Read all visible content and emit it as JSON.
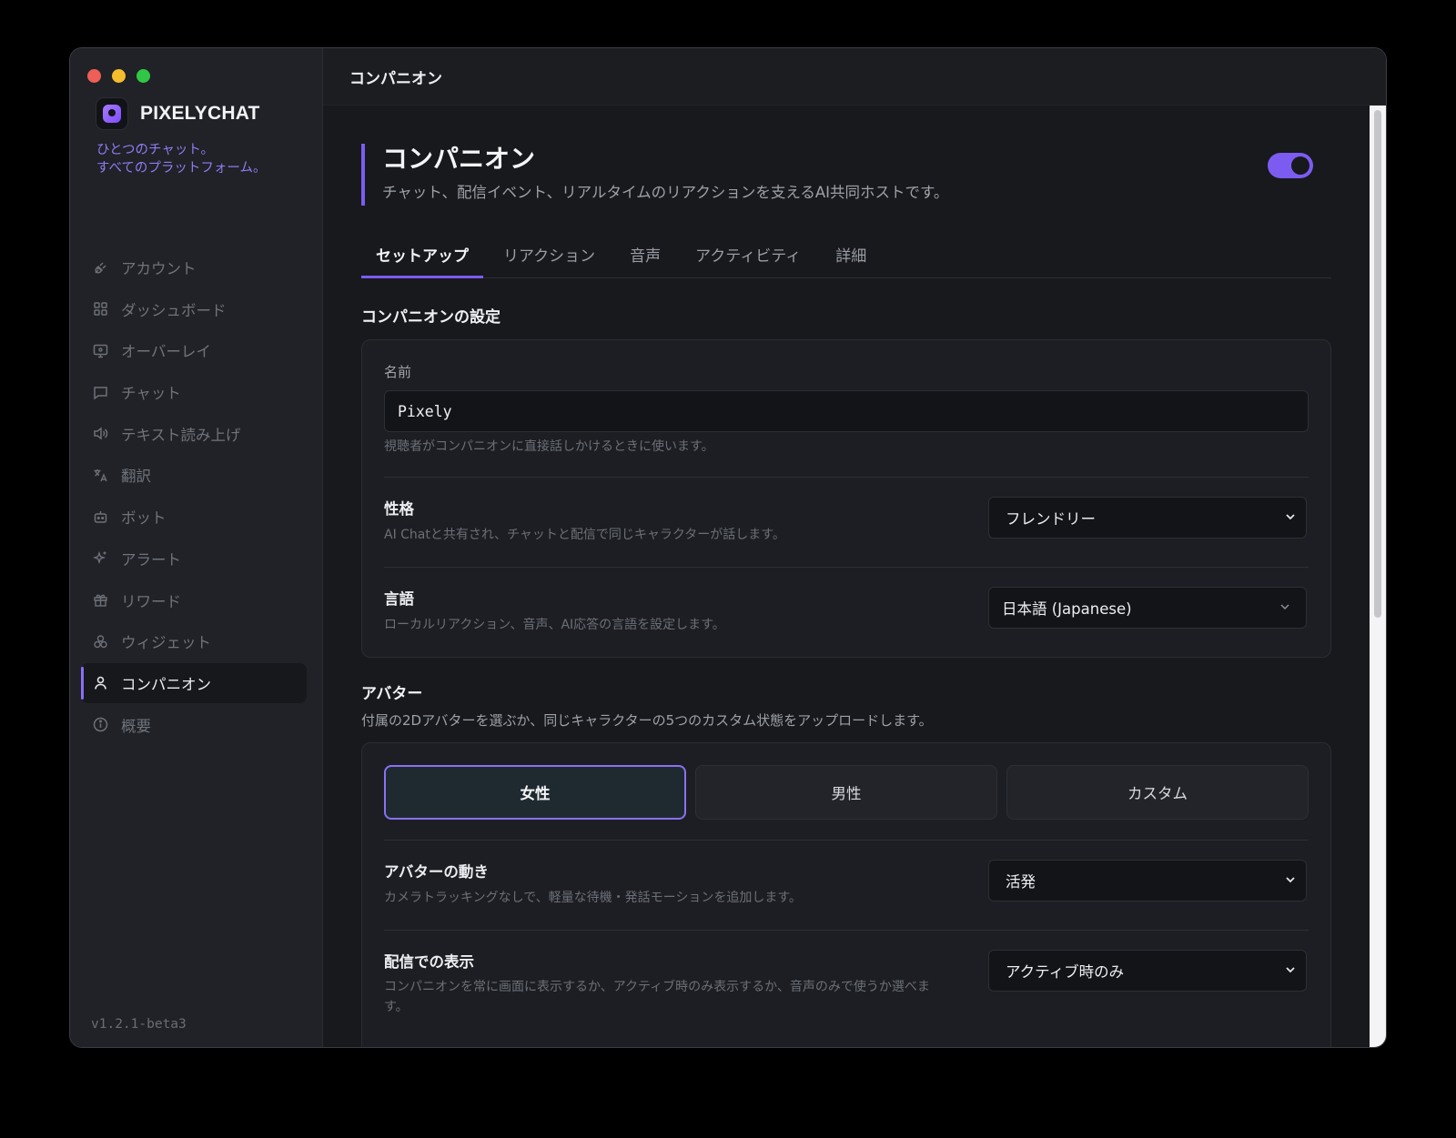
{
  "sidebar": {
    "brand_name": "PIXELYCHAT",
    "tagline_line1": "ひとつのチャット。",
    "tagline_line2": "すべてのプラットフォーム。",
    "items": [
      {
        "label": "アカウント",
        "icon": "plug-icon"
      },
      {
        "label": "ダッシュボード",
        "icon": "grid-icon"
      },
      {
        "label": "オーバーレイ",
        "icon": "monitor-icon"
      },
      {
        "label": "チャット",
        "icon": "chat-bubble-icon"
      },
      {
        "label": "テキスト読み上げ",
        "icon": "speaker-icon"
      },
      {
        "label": "翻訳",
        "icon": "translate-icon"
      },
      {
        "label": "ボット",
        "icon": "robot-icon"
      },
      {
        "label": "アラート",
        "icon": "sparkle-icon"
      },
      {
        "label": "リワード",
        "icon": "gift-icon"
      },
      {
        "label": "ウィジェット",
        "icon": "widget-icon"
      },
      {
        "label": "コンパニオン",
        "icon": "user-icon",
        "active": true
      },
      {
        "label": "概要",
        "icon": "info-icon"
      }
    ],
    "version": "v1.2.1-beta3"
  },
  "topbar": {
    "title": "コンパニオン"
  },
  "header": {
    "title": "コンパニオン",
    "description": "チャット、配信イベント、リアルタイムのリアクションを支えるAI共同ホストです。",
    "enabled": true
  },
  "tabs": [
    {
      "label": "セットアップ",
      "active": true
    },
    {
      "label": "リアクション"
    },
    {
      "label": "音声"
    },
    {
      "label": "アクティビティ"
    },
    {
      "label": "詳細"
    }
  ],
  "settings": {
    "title": "コンパニオンの設定",
    "name_label": "名前",
    "name_value": "Pixely",
    "name_hint": "視聴者がコンパニオンに直接話しかけるときに使います。",
    "personality_label": "性格",
    "personality_hint": "AI Chatと共有され、チャットと配信で同じキャラクターが話します。",
    "personality_value": "フレンドリー",
    "language_label": "言語",
    "language_hint": "ローカルリアクション、音声、AI応答の言語を設定します。",
    "language_value": "日本語 (Japanese)"
  },
  "avatar": {
    "title": "アバター",
    "description": "付属の2Dアバターを選ぶか、同じキャラクターの5つのカスタム状態をアップロードします。",
    "options": [
      "女性",
      "男性",
      "カスタム"
    ],
    "selected": "女性",
    "motion_label": "アバターの動き",
    "motion_hint": "カメラトラッキングなしで、軽量な待機・発話モーションを追加します。",
    "motion_value": "活発",
    "display_label": "配信での表示",
    "display_hint_line1": "コンパニオンを常に画面に表示するか、アクティブ時のみ表示するか、音声のみで使うか選べま",
    "display_hint_line2": "す。",
    "display_value": "アクティブ時のみ"
  },
  "colors": {
    "accent": "#7d5cf0",
    "tagline": "#8f7bf3"
  }
}
